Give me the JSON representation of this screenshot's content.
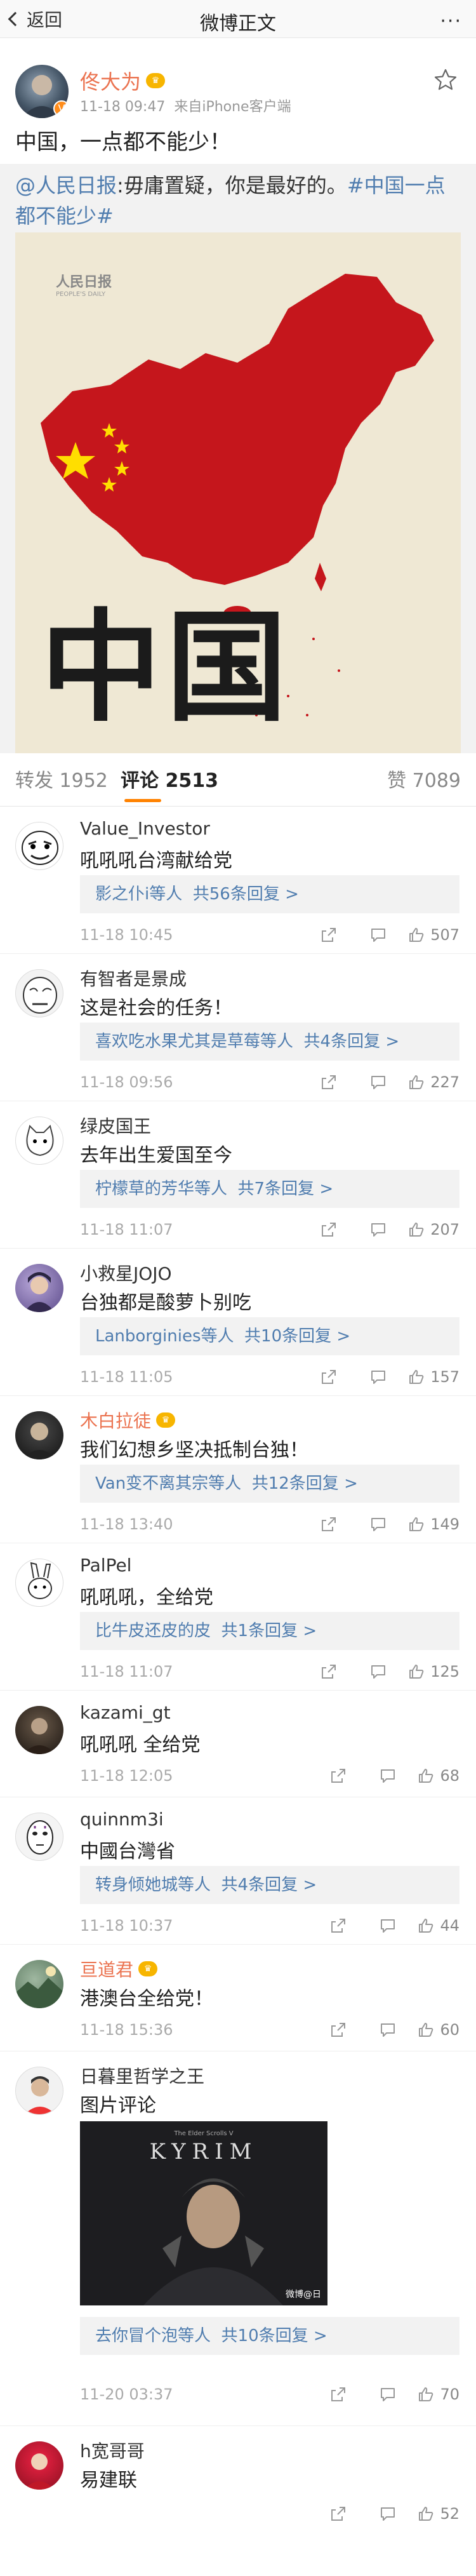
{
  "nav": {
    "back_label": "返回",
    "title": "微博正文",
    "more": "···"
  },
  "post": {
    "author": "佟大为",
    "time": "11-18 09:47",
    "source": "来自iPhone客户端",
    "text": "中国，一点都不能少！",
    "repost": {
      "author_link": "@人民日报",
      "body": ":毋庸置疑，你是最好的。",
      "hashtag": "#中国一点都不能少#"
    },
    "image": {
      "brand": "人民日报",
      "brand_en": "PEOPLE'S DAILY",
      "chars": "中国"
    }
  },
  "tabs": {
    "repost_label": "转发",
    "repost_count": "1952",
    "comment_label": "评论",
    "comment_count": "2513",
    "like_label": "赞",
    "like_count": "7089"
  },
  "comments": [
    {
      "name": "Value_Investor",
      "text": "吼吼吼台湾献给党",
      "replies": "影之仆i等人",
      "replies_count": "共56条回复 >",
      "time": "11-18 10:45",
      "likes": "507"
    },
    {
      "name": "有智者是景成",
      "text": "这是社会的任务！",
      "replies": "喜欢吃水果尤其是草莓等人",
      "replies_count": "共4条回复 >",
      "time": "11-18 09:56",
      "likes": "227"
    },
    {
      "name": "绿皮国王",
      "text": "去年出生爱国至今",
      "replies": "柠檬草的芳华等人",
      "replies_count": "共7条回复 >",
      "time": "11-18 11:07",
      "likes": "207"
    },
    {
      "name": "小救星JOJO",
      "text": "台独都是酸萝卜别吃",
      "replies": "Lanborginies等人",
      "replies_count": "共10条回复 >",
      "time": "11-18 11:05",
      "likes": "157"
    },
    {
      "name": "木白拉徒",
      "text": "我们幻想乡坚决抵制台独！",
      "replies": "Van变不离其宗等人",
      "replies_count": "共12条回复 >",
      "time": "11-18 13:40",
      "likes": "149"
    },
    {
      "name": "PalPel",
      "text": "吼吼吼，全给党",
      "replies": "比牛皮还皮的皮",
      "replies_count": "共1条回复 >",
      "time": "11-18 11:07",
      "likes": "125"
    },
    {
      "name": "kazami_gt",
      "text": "吼吼吼 全给党",
      "time": "11-18 12:05",
      "likes": "68"
    },
    {
      "name": "quinnm3i",
      "text": "中國台灣省",
      "replies": "转身倾她城等人",
      "replies_count": "共4条回复 >",
      "time": "11-18 10:37",
      "likes": "44"
    },
    {
      "name": "亘道君",
      "text": "港澳台全给党！",
      "time": "11-18 15:36",
      "likes": "60"
    },
    {
      "name": "日暮里哲学之王",
      "text": "图片评论",
      "image_title": "KYRIM",
      "image_sub": "The Elder Scrolls V",
      "image_wm": "微博@日",
      "replies": "去你冒个泡等人",
      "replies_count": "共10条回复 >",
      "time": "11-20 03:37",
      "likes": "70"
    },
    {
      "name": "h宽哥哥",
      "text": "易建联",
      "likes": "52"
    }
  ],
  "colors": {
    "accent": "#ff8200",
    "link": "#507daf",
    "name_highlight": "#eb7350"
  }
}
